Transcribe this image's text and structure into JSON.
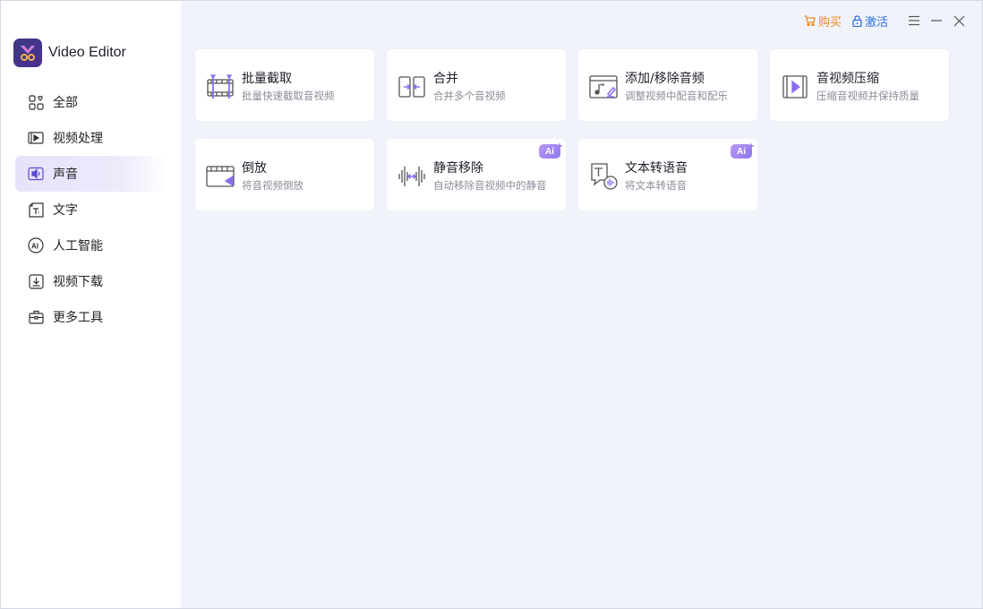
{
  "app": {
    "name": "Video Editor"
  },
  "topbar": {
    "buy_label": "购买",
    "activate_label": "激活",
    "buy_color": "#f08a1c",
    "activate_color": "#2c6fde"
  },
  "sidebar": {
    "items": [
      {
        "label": "全部",
        "icon": "grid-icon"
      },
      {
        "label": "视频处理",
        "icon": "video-play-icon"
      },
      {
        "label": "声音",
        "icon": "audio-icon",
        "active": true
      },
      {
        "label": "文字",
        "icon": "text-icon"
      },
      {
        "label": "人工智能",
        "icon": "ai-icon"
      },
      {
        "label": "视频下载",
        "icon": "download-icon"
      },
      {
        "label": "更多工具",
        "icon": "toolbox-icon"
      }
    ]
  },
  "cards": [
    {
      "title": "批量截取",
      "desc": "批量快速截取音视频",
      "icon": "batch-trim-icon",
      "ai": false
    },
    {
      "title": "合并",
      "desc": "合并多个音视频",
      "icon": "merge-icon",
      "ai": false
    },
    {
      "title": "添加/移除音频",
      "desc": "调整视频中配音和配乐",
      "icon": "add-remove-audio-icon",
      "ai": false
    },
    {
      "title": "音视频压缩",
      "desc": "压缩音视频并保持质量",
      "icon": "compress-icon",
      "ai": false
    },
    {
      "title": "倒放",
      "desc": "将音视频倒放",
      "icon": "reverse-icon",
      "ai": false
    },
    {
      "title": "静音移除",
      "desc": "自动移除音视频中的静音",
      "icon": "silence-remove-icon",
      "ai": true,
      "badge": "Ai"
    },
    {
      "title": "文本转语音",
      "desc": "将文本转语音",
      "icon": "text-to-speech-icon",
      "ai": true,
      "badge": "Ai"
    }
  ],
  "colors": {
    "accent": "#8b6cf0",
    "active_nav_bg": "#e6e2fb",
    "background": "#f1f3fb"
  }
}
